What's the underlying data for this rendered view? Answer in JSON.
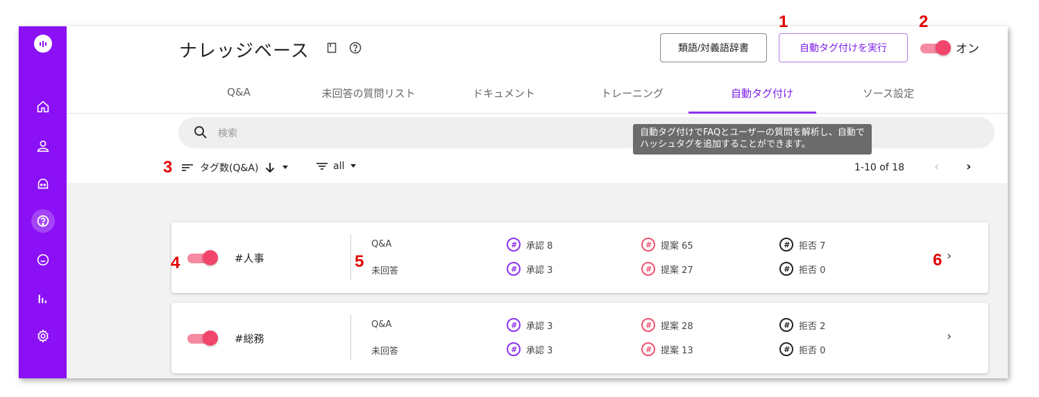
{
  "header": {
    "title": "ナレッジベース",
    "dict_button": "類語/対義語辞書",
    "auto_tag_button": "自動タグ付けを実行",
    "toggle_label": "オン"
  },
  "tabs": [
    {
      "label": "Q&A"
    },
    {
      "label": "未回答の質問リスト"
    },
    {
      "label": "ドキュメント"
    },
    {
      "label": "トレーニング"
    },
    {
      "label": "自動タグ付け",
      "active": true
    },
    {
      "label": "ソース設定"
    }
  ],
  "search": {
    "placeholder": "検索"
  },
  "tooltip": "自動タグ付けでFAQとユーザーの質問を解析し、自動でハッシュタグを追加することができます。",
  "filter": {
    "sort_label": "タグ数(Q&A)",
    "filter_value": "all",
    "pagination": "1-10 of 18"
  },
  "annotations": [
    "1",
    "2",
    "3",
    "4",
    "5",
    "6"
  ],
  "tags": [
    {
      "name": "#人事",
      "enabled": true,
      "qa_label": "Q&A",
      "unanswered_label": "未回答",
      "qa": {
        "approve": "承認 8",
        "suggest": "提案 65",
        "reject": "拒否 7"
      },
      "unanswered": {
        "approve": "承認 3",
        "suggest": "提案 27",
        "reject": "拒否 0"
      }
    },
    {
      "name": "#総務",
      "enabled": true,
      "qa_label": "Q&A",
      "unanswered_label": "未回答",
      "qa": {
        "approve": "承認 3",
        "suggest": "提案 28",
        "reject": "拒否 2"
      },
      "unanswered": {
        "approve": "承認 3",
        "suggest": "提案 13",
        "reject": "拒否 0"
      }
    }
  ],
  "colors": {
    "sidebar": "#8b10f5",
    "accent": "#7c1ce8",
    "toggle": "#f2456b",
    "annotation": "#e00000"
  },
  "icons": {
    "hash_glyph": "#"
  }
}
